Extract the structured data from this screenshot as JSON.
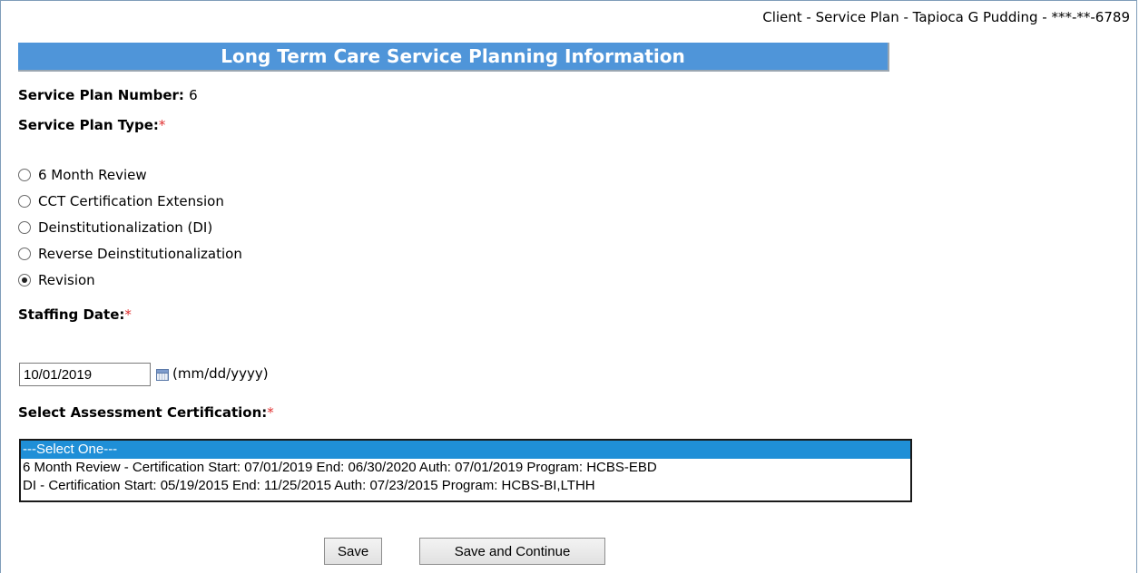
{
  "header": {
    "breadcrumb": "Client - Service Plan - Tapioca G Pudding - ***-**-6789",
    "title": "Long Term Care Service Planning Information"
  },
  "plan_number": {
    "label": "Service Plan Number:",
    "value": "6"
  },
  "plan_type": {
    "label": "Service Plan Type:",
    "required_mark": "*",
    "options": [
      {
        "label": "6 Month Review",
        "checked": false
      },
      {
        "label": "CCT Certification Extension",
        "checked": false
      },
      {
        "label": "Deinstitutionalization (DI)",
        "checked": false
      },
      {
        "label": "Reverse Deinstitutionalization",
        "checked": false
      },
      {
        "label": "Revision",
        "checked": true
      }
    ]
  },
  "staffing_date": {
    "label": "Staffing Date:",
    "required_mark": "*",
    "value": "10/01/2019",
    "format_hint": "(mm/dd/yyyy)"
  },
  "assessment": {
    "label": "Select Assessment Certification:",
    "required_mark": "*",
    "options": [
      {
        "label": "---Select One---",
        "selected": true
      },
      {
        "label": "6 Month Review - Certification Start: 07/01/2019 End: 06/30/2020 Auth: 07/01/2019 Program: HCBS-EBD",
        "selected": false
      },
      {
        "label": "DI - Certification Start: 05/19/2015 End: 11/25/2015 Auth: 07/23/2015 Program: HCBS-BI,LTHH",
        "selected": false
      }
    ]
  },
  "actions": {
    "save": "Save",
    "save_continue": "Save and Continue"
  },
  "colors": {
    "title_bar": "#4f95d9",
    "selected_option": "#1f8fd7",
    "required": "#e03030"
  }
}
